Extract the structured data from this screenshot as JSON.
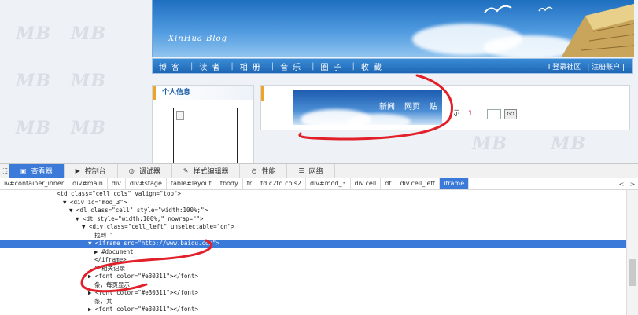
{
  "blog": {
    "title": "XinHua Blog",
    "nav": [
      "博客",
      "读者",
      "相册",
      "音乐",
      "圈子",
      "收藏"
    ],
    "nav_right": [
      "I 登录社区",
      "| 注册账户 |"
    ],
    "sidebar_title": "个人信息",
    "iframe_nav": [
      "新闻",
      "网页",
      "贴"
    ],
    "stat_label": "示",
    "stat_value": "1",
    "go_label": "GO"
  },
  "devtools": {
    "tabs": [
      {
        "label": "查看器",
        "icon": "inspector-icon"
      },
      {
        "label": "控制台",
        "icon": "console-icon"
      },
      {
        "label": "调试器",
        "icon": "debugger-icon"
      },
      {
        "label": "样式编辑器",
        "icon": "style-editor-icon"
      },
      {
        "label": "性能",
        "icon": "performance-icon"
      },
      {
        "label": "网络",
        "icon": "network-icon"
      }
    ],
    "breadcrumbs": [
      "iv#container_inner",
      "div#main",
      "div",
      "div#stage",
      "table#layout",
      "tbody",
      "tr",
      "td.c2td.cols2",
      "div#mod_3",
      "div.cell",
      "dt",
      "div.cell_left",
      "iframe"
    ],
    "crumb_prev": "<",
    "crumb_next": ">",
    "tree": [
      {
        "indent": 18,
        "text": "<td class=\"cell cols\" valign=\"top\">"
      },
      {
        "indent": 20,
        "text": "▼ <div id=\"mod_3\">"
      },
      {
        "indent": 22,
        "text": "▼ <dl class=\"cell\" style=\"width:100%;\">"
      },
      {
        "indent": 24,
        "text": "▼ <dt style=\"width:100%;\" nowrap=\"\">"
      },
      {
        "indent": 26,
        "text": "▼ <div class=\"cell_left\" unselectable=\"on\">"
      },
      {
        "indent": 30,
        "text": "找到 \""
      },
      {
        "indent": 28,
        "text": "▼ <iframe src=\"http://www.baidu.com\">",
        "selected": true
      },
      {
        "indent": 30,
        "text": "▶ #document"
      },
      {
        "indent": 30,
        "text": "</iframe>"
      },
      {
        "indent": 30,
        "text": "\" 相关记录"
      },
      {
        "indent": 28,
        "text": "▶ <font color=\"#e30311\"></font>"
      },
      {
        "indent": 30,
        "text": "条，每页显示"
      },
      {
        "indent": 28,
        "text": "▶ <font color=\"#e30311\"></font>"
      },
      {
        "indent": 30,
        "text": "条，共"
      },
      {
        "indent": 28,
        "text": "▶ <font color=\"#e30311\"></font>"
      }
    ]
  },
  "colors": {
    "accent": "#3c7ad9",
    "banner": "#4f9ae0",
    "highlight": "#f0a326",
    "annotation": "#e2202a"
  }
}
